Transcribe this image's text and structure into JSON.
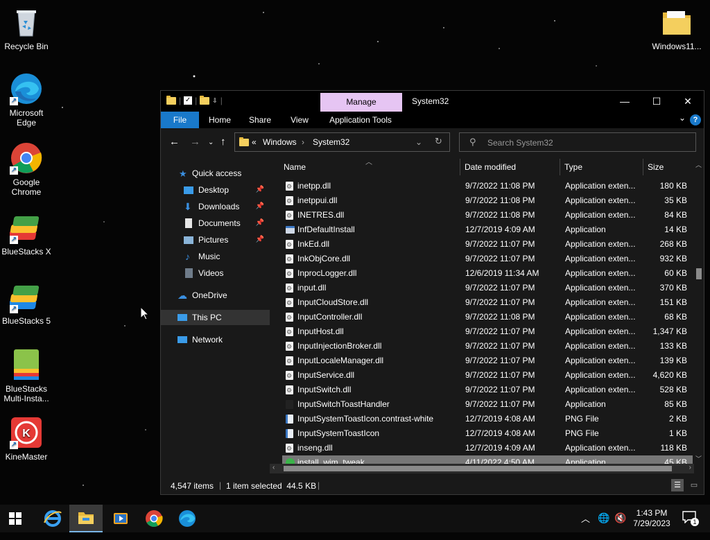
{
  "desktop": {
    "icons": [
      {
        "label": "Recycle Bin"
      },
      {
        "label": "Microsoft Edge"
      },
      {
        "label": "Google Chrome"
      },
      {
        "label": "BlueStacks X"
      },
      {
        "label": "BlueStacks 5"
      },
      {
        "label": "BlueStacks Multi-Insta..."
      },
      {
        "label": "KineMaster"
      },
      {
        "label": "Windows11..."
      }
    ]
  },
  "window": {
    "title": "System32",
    "manage_tab": "Manage",
    "ribbon": {
      "file": "File",
      "home": "Home",
      "share": "Share",
      "view": "View",
      "app_tools": "Application Tools"
    },
    "address": {
      "prefix": "«",
      "crumb1": "Windows",
      "sep": "›",
      "crumb2": "System32"
    },
    "search_placeholder": "Search System32",
    "nav": {
      "quick_access": "Quick access",
      "desktop": "Desktop",
      "downloads": "Downloads",
      "documents": "Documents",
      "pictures": "Pictures",
      "music": "Music",
      "videos": "Videos",
      "onedrive": "OneDrive",
      "this_pc": "This PC",
      "network": "Network"
    },
    "columns": {
      "name": "Name",
      "date": "Date modified",
      "type": "Type",
      "size": "Size"
    },
    "files": [
      {
        "name": "inetpp.dll",
        "date": "9/7/2022 11:08 PM",
        "type": "Application exten...",
        "size": "180 KB",
        "icon": "dll"
      },
      {
        "name": "inetppui.dll",
        "date": "9/7/2022 11:08 PM",
        "type": "Application exten...",
        "size": "35 KB",
        "icon": "dll"
      },
      {
        "name": "INETRES.dll",
        "date": "9/7/2022 11:08 PM",
        "type": "Application exten...",
        "size": "84 KB",
        "icon": "dll"
      },
      {
        "name": "InfDefaultInstall",
        "date": "12/7/2019 4:09 AM",
        "type": "Application",
        "size": "14 KB",
        "icon": "app"
      },
      {
        "name": "InkEd.dll",
        "date": "9/7/2022 11:07 PM",
        "type": "Application exten...",
        "size": "268 KB",
        "icon": "dll"
      },
      {
        "name": "InkObjCore.dll",
        "date": "9/7/2022 11:07 PM",
        "type": "Application exten...",
        "size": "932 KB",
        "icon": "dll"
      },
      {
        "name": "InprocLogger.dll",
        "date": "12/6/2019 11:34 AM",
        "type": "Application exten...",
        "size": "60 KB",
        "icon": "dll"
      },
      {
        "name": "input.dll",
        "date": "9/7/2022 11:07 PM",
        "type": "Application exten...",
        "size": "370 KB",
        "icon": "dll"
      },
      {
        "name": "InputCloudStore.dll",
        "date": "9/7/2022 11:07 PM",
        "type": "Application exten...",
        "size": "151 KB",
        "icon": "dll"
      },
      {
        "name": "InputController.dll",
        "date": "9/7/2022 11:08 PM",
        "type": "Application exten...",
        "size": "68 KB",
        "icon": "dll"
      },
      {
        "name": "InputHost.dll",
        "date": "9/7/2022 11:07 PM",
        "type": "Application exten...",
        "size": "1,347 KB",
        "icon": "dll"
      },
      {
        "name": "InputInjectionBroker.dll",
        "date": "9/7/2022 11:07 PM",
        "type": "Application exten...",
        "size": "133 KB",
        "icon": "dll"
      },
      {
        "name": "InputLocaleManager.dll",
        "date": "9/7/2022 11:07 PM",
        "type": "Application exten...",
        "size": "139 KB",
        "icon": "dll"
      },
      {
        "name": "InputService.dll",
        "date": "9/7/2022 11:07 PM",
        "type": "Application exten...",
        "size": "4,620 KB",
        "icon": "dll"
      },
      {
        "name": "InputSwitch.dll",
        "date": "9/7/2022 11:07 PM",
        "type": "Application exten...",
        "size": "528 KB",
        "icon": "dll"
      },
      {
        "name": "InputSwitchToastHandler",
        "date": "9/7/2022 11:07 PM",
        "type": "Application",
        "size": "85 KB",
        "icon": "dark"
      },
      {
        "name": "InputSystemToastIcon.contrast-white",
        "date": "12/7/2019 4:08 AM",
        "type": "PNG File",
        "size": "2 KB",
        "icon": "png"
      },
      {
        "name": "InputSystemToastIcon",
        "date": "12/7/2019 4:08 AM",
        "type": "PNG File",
        "size": "1 KB",
        "icon": "png"
      },
      {
        "name": "inseng.dll",
        "date": "12/7/2019 4:09 AM",
        "type": "Application exten...",
        "size": "118 KB",
        "icon": "dll"
      },
      {
        "name": "install_wim_tweak",
        "date": "4/11/2022 4:50 AM",
        "type": "Application",
        "size": "45 KB",
        "icon": "green",
        "selected": true
      }
    ],
    "status": {
      "items": "4,547 items",
      "selected": "1 item selected  44.5 KB"
    }
  },
  "taskbar": {
    "time": "1:43 PM",
    "date": "7/29/2023",
    "notifications": "1"
  }
}
